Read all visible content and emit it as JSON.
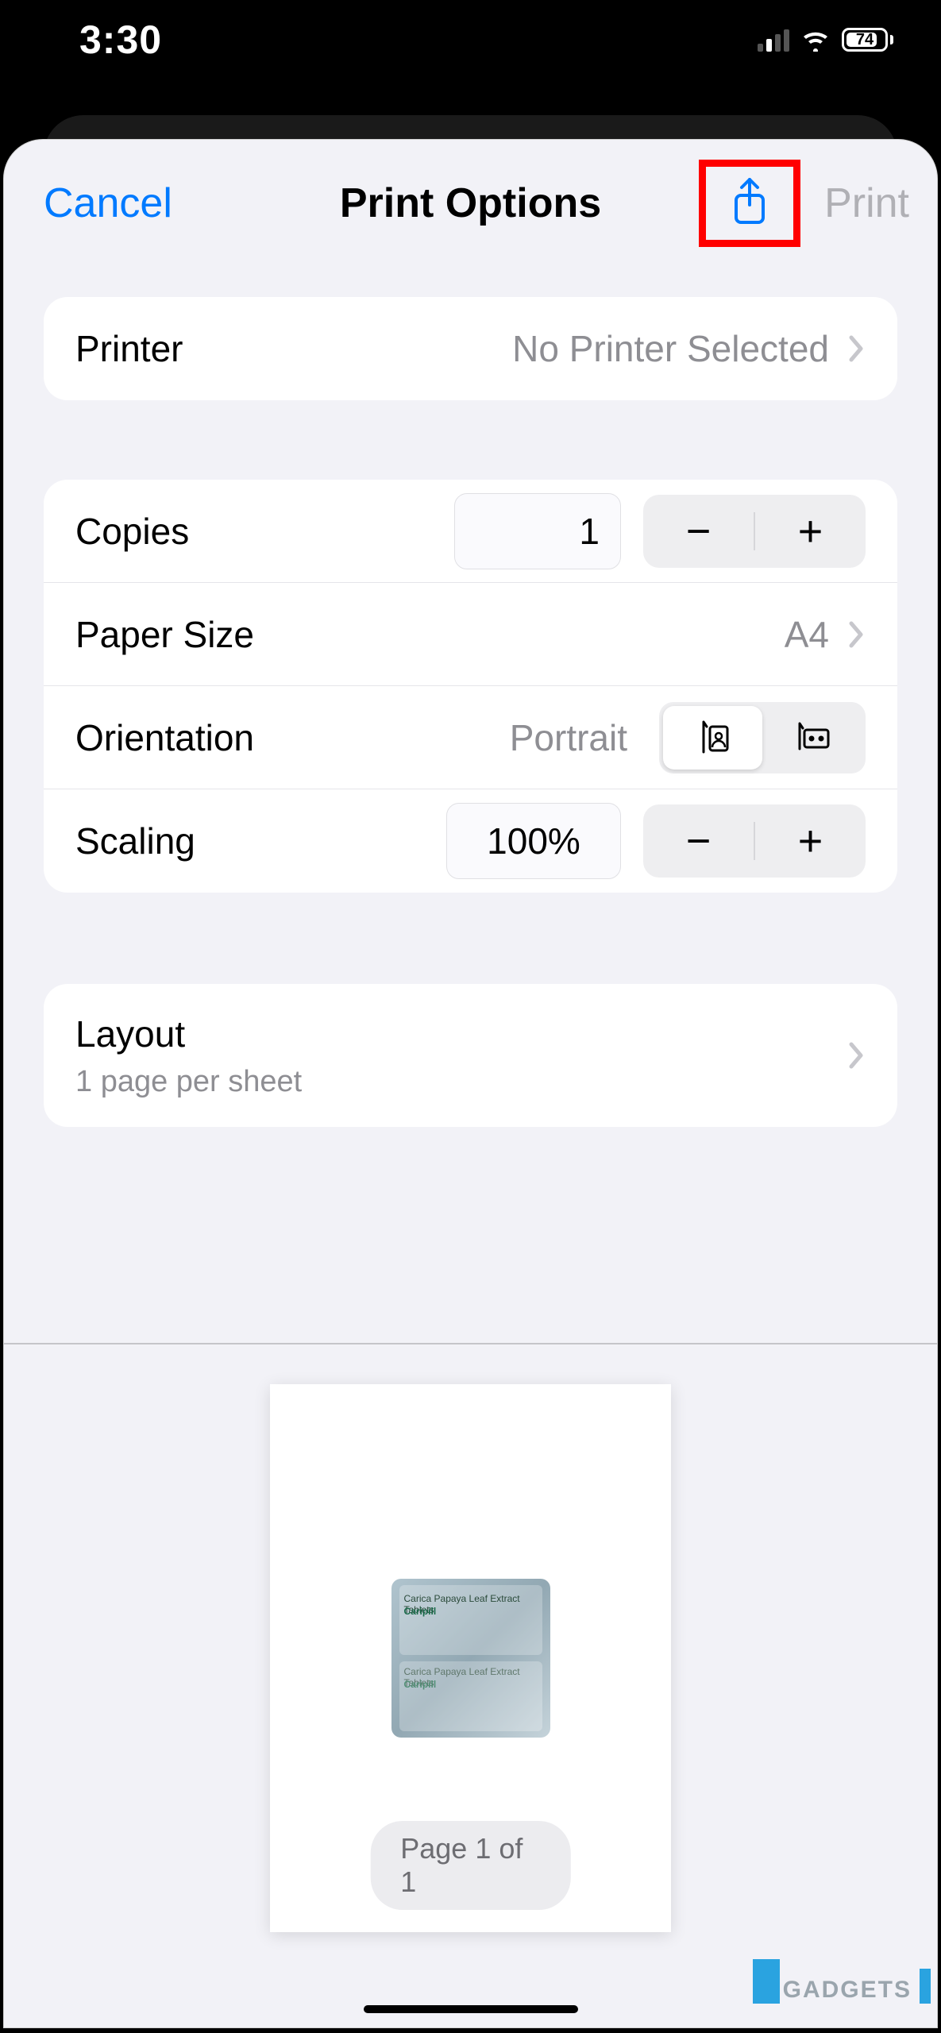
{
  "status": {
    "time": "3:30",
    "battery": "74"
  },
  "nav": {
    "cancel": "Cancel",
    "title": "Print Options",
    "print": "Print"
  },
  "printer": {
    "label": "Printer",
    "value": "No Printer Selected"
  },
  "copies": {
    "label": "Copies",
    "value": "1"
  },
  "paper": {
    "label": "Paper Size",
    "value": "A4"
  },
  "orientation": {
    "label": "Orientation",
    "value": "Portrait"
  },
  "scaling": {
    "label": "Scaling",
    "value": "100%"
  },
  "layout": {
    "label": "Layout",
    "sub": "1 page per sheet"
  },
  "preview": {
    "page_label": "Page 1 of 1",
    "doc_line1": "Carica Papaya Leaf Extract Tablets",
    "doc_line2": "Caripill"
  },
  "watermark": "GADGETS"
}
